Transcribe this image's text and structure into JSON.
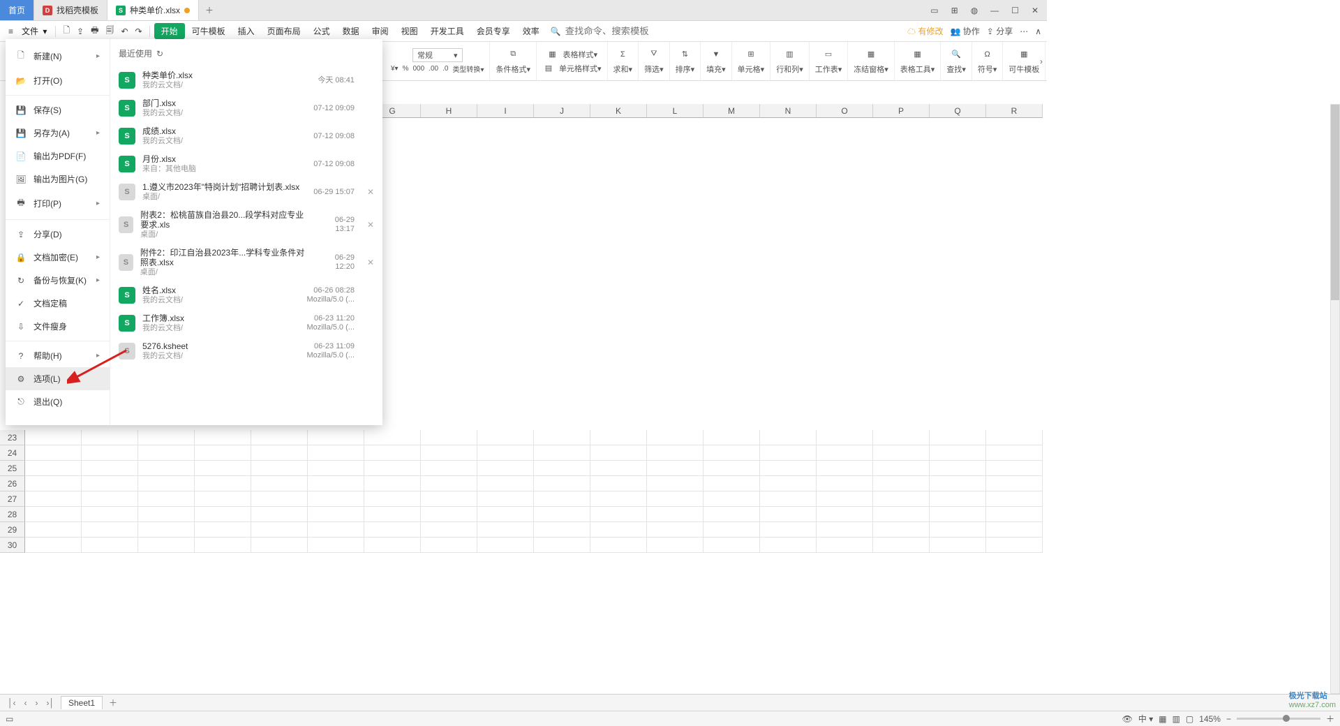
{
  "tabs": {
    "home": "首页",
    "t1": "找稻壳模板",
    "t2": "种类单价.xlsx"
  },
  "menubar": {
    "file": "文件",
    "items": [
      "开始",
      "可牛模板",
      "插入",
      "页面布局",
      "公式",
      "数据",
      "审阅",
      "视图",
      "开发工具",
      "会员专享",
      "效率"
    ],
    "searchPlaceholder": "查找命令、搜索模板",
    "right": {
      "changes": "有修改",
      "coop": "协作",
      "share": "分享"
    }
  },
  "ribbon": {
    "numFormat": "常规",
    "typeConvert": "类型转换",
    "cond": "条件格式",
    "tableStyle": "表格样式",
    "cellStyle": "单元格样式",
    "sum": "求和",
    "filter": "筛选",
    "sort": "排序",
    "fill": "填充",
    "cells": "单元格",
    "rowscols": "行和列",
    "sheet": "工作表",
    "freeze": "冻结窗格",
    "tools": "表格工具",
    "find": "查找",
    "symbol": "符号",
    "template": "可牛模板"
  },
  "fileMenu": {
    "items": {
      "new": "新建(N)",
      "open": "打开(O)",
      "save": "保存(S)",
      "saveAs": "另存为(A)",
      "pdf": "输出为PDF(F)",
      "img": "输出为图片(G)",
      "print": "打印(P)",
      "share": "分享(D)",
      "encrypt": "文档加密(E)",
      "backup": "备份与恢复(K)",
      "finalize": "文档定稿",
      "slim": "文件瘦身",
      "help": "帮助(H)",
      "options": "选项(L)",
      "exit": "退出(Q)"
    },
    "recentHeader": "最近使用",
    "recents": [
      {
        "name": "种类单价.xlsx",
        "loc": "我的云文档/",
        "dt": "今天  08:41",
        "type": "g"
      },
      {
        "name": "部门.xlsx",
        "loc": "我的云文档/",
        "dt": "07-12 09:09",
        "type": "g"
      },
      {
        "name": "成绩.xlsx",
        "loc": "我的云文档/",
        "dt": "07-12 09:08",
        "type": "g"
      },
      {
        "name": "月份.xlsx",
        "loc": "来自：其他电脑",
        "dt": "07-12 09:08",
        "type": "g"
      },
      {
        "name": "1.遵义市2023年\"特岗计划\"招聘计划表.xlsx",
        "loc": "桌面/",
        "dt": "06-29 15:07",
        "type": "gray",
        "x": true
      },
      {
        "name": "附表2：松桃苗族自治县20...段学科对应专业要求.xls",
        "loc": "桌面/",
        "dt": "06-29 13:17",
        "type": "gray",
        "x": true
      },
      {
        "name": "附件2：印江自治县2023年...学科专业条件对照表.xlsx",
        "loc": "桌面/",
        "dt": "06-29 12:20",
        "type": "gray",
        "x": true
      },
      {
        "name": "姓名.xlsx",
        "loc": "我的云文档/",
        "dt": "06-26 08:28",
        "dt2": "Mozilla/5.0 (...",
        "type": "g"
      },
      {
        "name": "工作簿.xlsx",
        "loc": "我的云文档/",
        "dt": "06-23 11:20",
        "dt2": "Mozilla/5.0 (...",
        "type": "g"
      },
      {
        "name": "5276.ksheet",
        "loc": "我的云文档/",
        "dt": "06-23 11:09",
        "dt2": "Mozilla/5.0 (...",
        "type": "gray"
      }
    ]
  },
  "columns": [
    "G",
    "H",
    "I",
    "J",
    "K",
    "L",
    "M",
    "N",
    "O",
    "P",
    "Q",
    "R"
  ],
  "rowStart": 23,
  "rowEnd": 30,
  "sheet": "Sheet1",
  "zoom": "145%",
  "watermark": {
    "a": "极光下载站",
    "b": "www.xz7.com"
  }
}
